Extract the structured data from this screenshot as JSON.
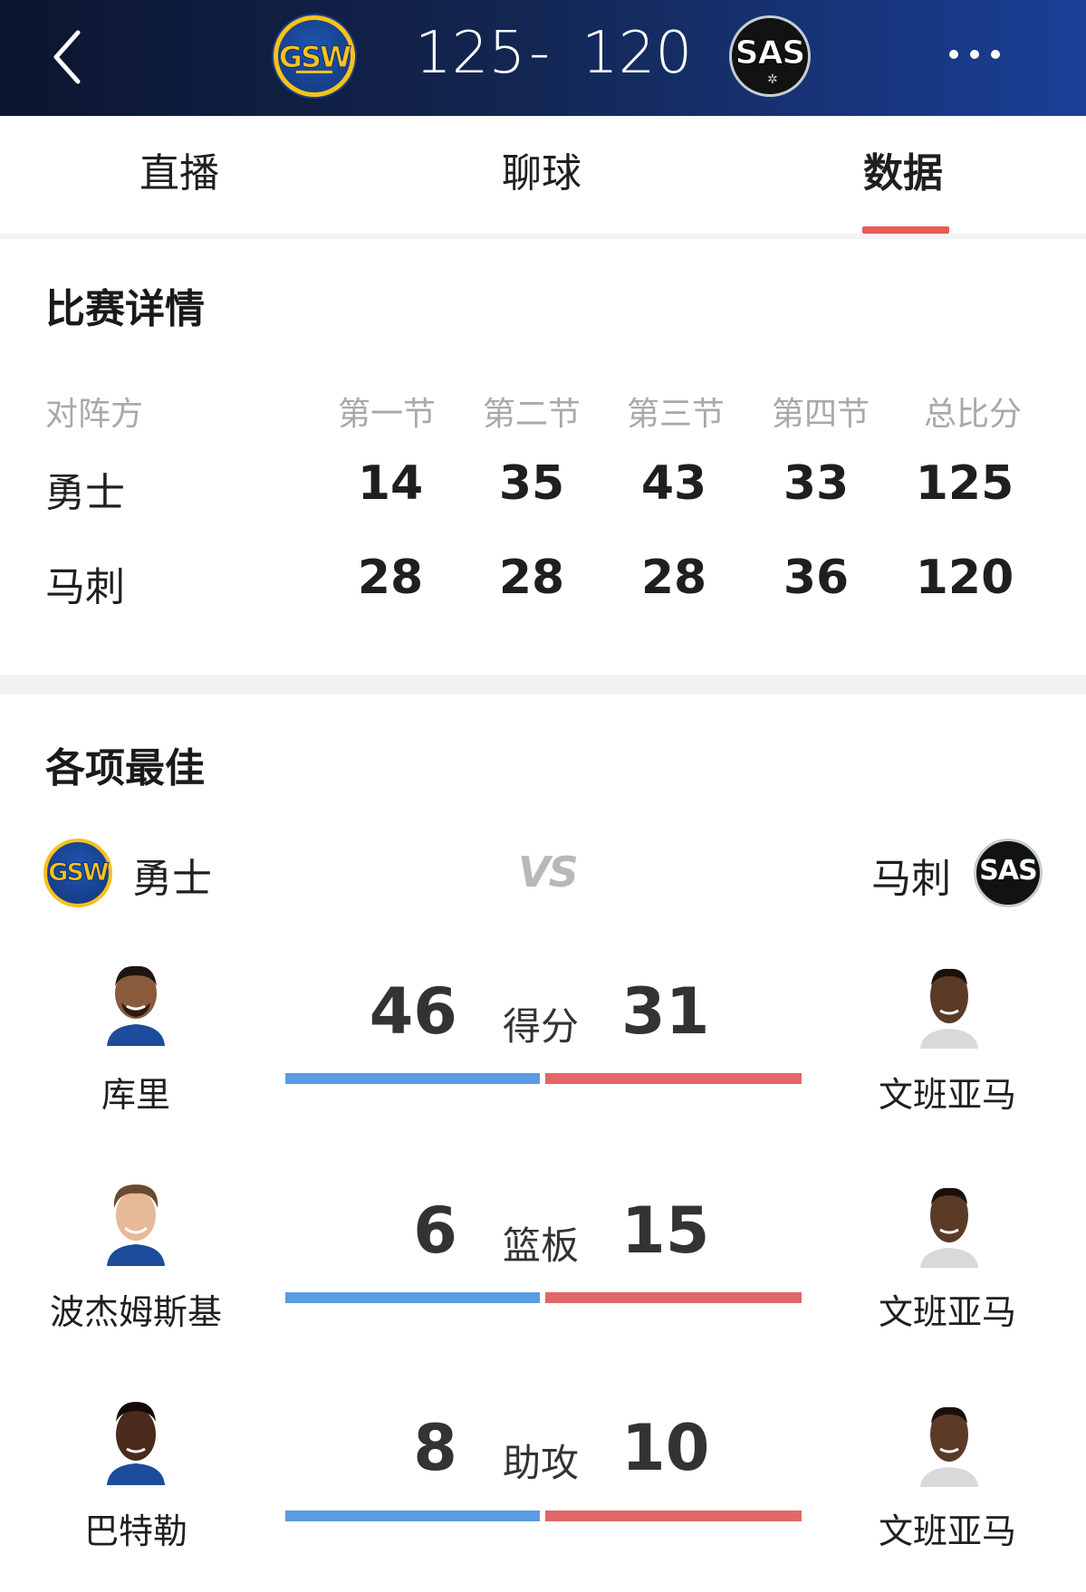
{
  "header": {
    "home_abbr": "GSW",
    "away_abbr": "SAS",
    "home_score": "125",
    "dash": "-",
    "away_score": "120"
  },
  "tabs": [
    {
      "label": "直播"
    },
    {
      "label": "聊球"
    },
    {
      "label": "数据"
    }
  ],
  "active_tab": "数据",
  "match_detail": {
    "title": "比赛详情",
    "headers": [
      "对阵方",
      "第一节",
      "第二节",
      "第三节",
      "第四节",
      "总比分"
    ],
    "rows": [
      {
        "team": "勇士",
        "q1": "14",
        "q2": "35",
        "q3": "43",
        "q4": "33",
        "total": "125"
      },
      {
        "team": "马刺",
        "q1": "28",
        "q2": "28",
        "q3": "28",
        "q4": "36",
        "total": "120"
      }
    ]
  },
  "leaders": {
    "title": "各项最佳",
    "home_team": "勇士",
    "away_team": "马刺",
    "vs": "VS",
    "rows": [
      {
        "label": "得分",
        "home_player": "库里",
        "home_value": "46",
        "away_player": "文班亚马",
        "away_value": "31"
      },
      {
        "label": "篮板",
        "home_player": "波杰姆斯基",
        "home_value": "6",
        "away_player": "文班亚马",
        "away_value": "15"
      },
      {
        "label": "助攻",
        "home_player": "巴特勒",
        "home_value": "8",
        "away_player": "文班亚马",
        "away_value": "10"
      }
    ]
  },
  "colors": {
    "header_bg": "#13254f",
    "tab_underline": "#e25b5b",
    "home_bar": "#5b9be0",
    "away_bar": "#e26767"
  },
  "icons": [
    "back-arrow-icon",
    "more-dots-icon",
    "gsw-logo",
    "sas-logo"
  ]
}
